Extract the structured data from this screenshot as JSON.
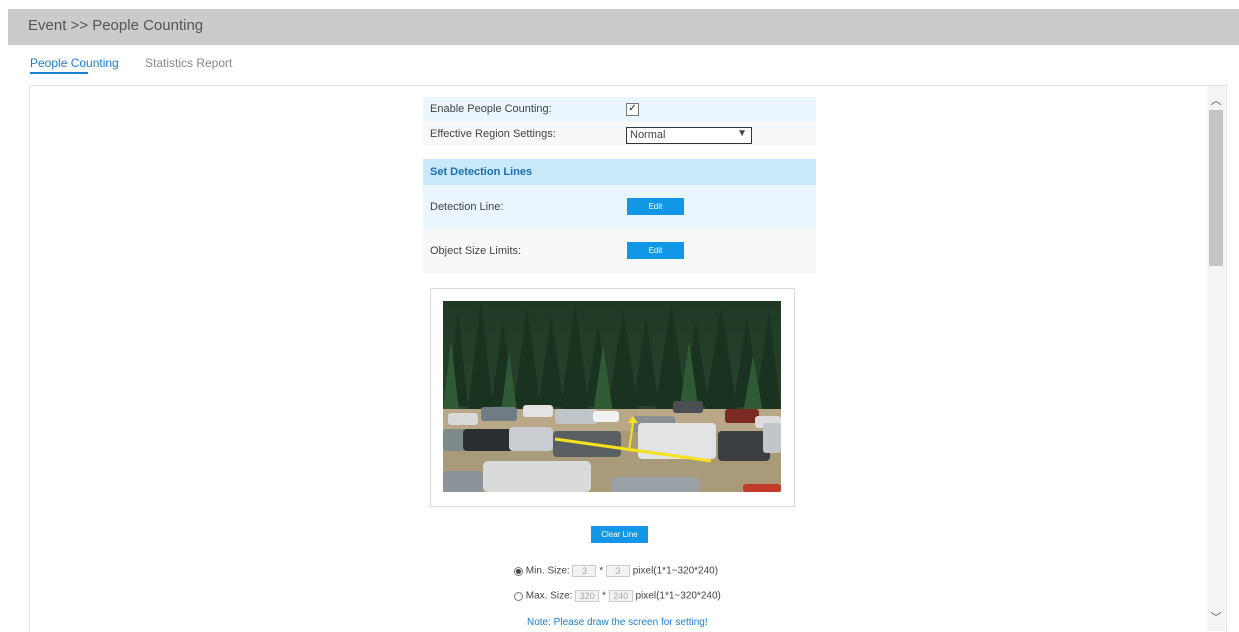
{
  "header": {
    "title": "Event >> People Counting"
  },
  "tabs": [
    {
      "label": "People Counting",
      "active": true
    },
    {
      "label": "Statistics Report",
      "active": false
    }
  ],
  "form": {
    "enable_label": "Enable People Counting:",
    "enable_checked": true,
    "region_label": "Effective Region Settings:",
    "region_value": "Normal",
    "section_title": "Set Detection Lines",
    "detection_line_label": "Detection Line:",
    "detection_line_button": "Edit",
    "object_size_label": "Object Size Limits:",
    "object_size_button": "Edit"
  },
  "video": {
    "clear_button": "Clear Line"
  },
  "sizes": {
    "min_label": "Min. Size:",
    "min_w": "3",
    "min_h": "3",
    "max_label": "Max. Size:",
    "max_w": "320",
    "max_h": "240",
    "times": "*",
    "range_hint": "pixel(1*1~320*240)",
    "selected": "min"
  },
  "note": "Note: Please draw the screen for setting!",
  "colors": {
    "accent": "#1296e6",
    "header_bg": "#cbcbcb",
    "section_bg": "#c9e9f8",
    "row_bg": "#e9f6fd"
  }
}
